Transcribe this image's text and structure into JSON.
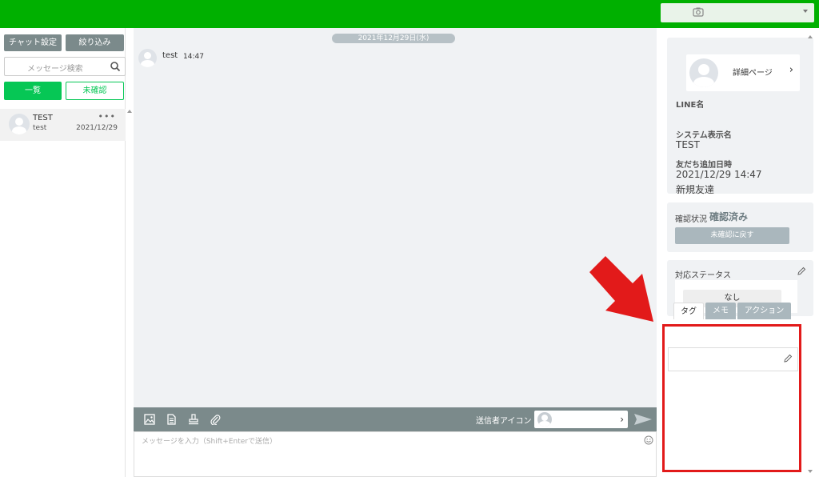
{
  "left": {
    "chat_settings_label": "チャット設定",
    "filter_label": "絞り込み",
    "search_placeholder": "メッセージ検索",
    "tab_all": "一覧",
    "tab_unread": "未確認",
    "conversations": [
      {
        "name": "TEST",
        "preview": "test",
        "date": "2021/12/29",
        "menu": "•••"
      }
    ]
  },
  "chat": {
    "date_divider": "2021年12月29日(水)",
    "message": {
      "text": "test",
      "time": "14:47"
    },
    "sender_icon_label": "送信者アイコン",
    "input_placeholder": "メッセージを入力（Shift+Enterで送信）"
  },
  "profile": {
    "detail_label": "詳細ページ",
    "line_name_label": "LINE名",
    "line_name_value": "",
    "system_name_label": "システム表示名",
    "system_name_value": "TEST",
    "added_label": "友だち追加日時",
    "added_value": "2021/12/29 14:47",
    "friend_type": "新規友達"
  },
  "confirm": {
    "label": "確認状況",
    "value": "確認済み",
    "revert_button": "未確認に戻す"
  },
  "status": {
    "label": "対応ステータス",
    "value": "なし"
  },
  "tabs": {
    "tag": "タグ",
    "memo": "メモ",
    "action": "アクション"
  },
  "colors": {
    "brand_green": "#00b000",
    "line_green": "#06c755",
    "highlight_red": "#e21a1a"
  }
}
